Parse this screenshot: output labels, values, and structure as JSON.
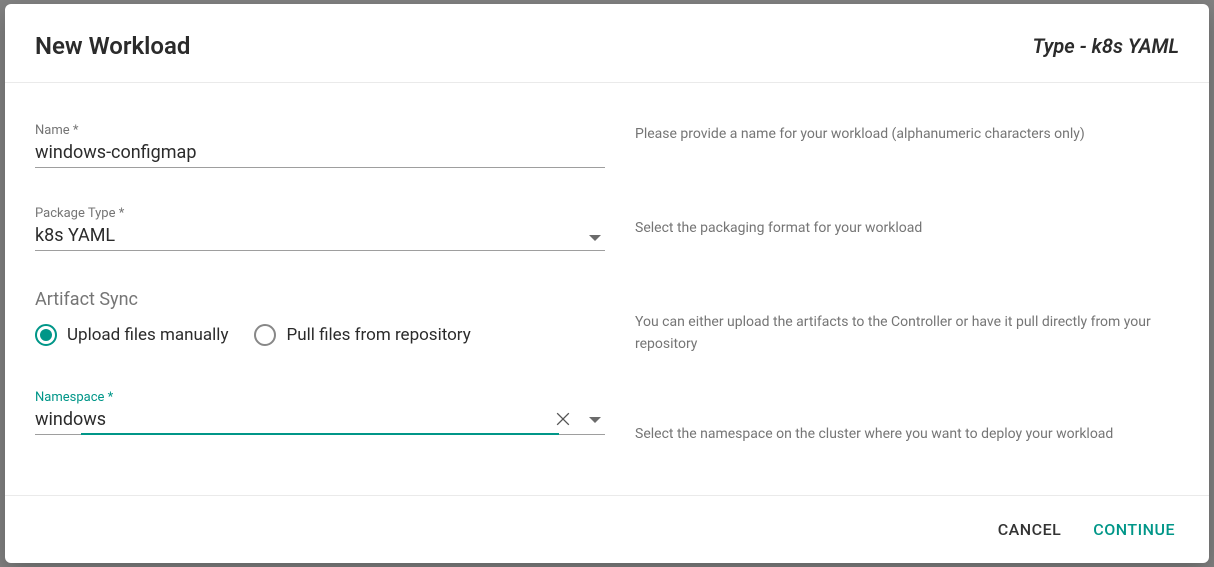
{
  "header": {
    "title": "New Workload",
    "type_label": "Type - k8s YAML"
  },
  "form": {
    "name": {
      "label": "Name *",
      "value": "windows-configmap"
    },
    "package_type": {
      "label": "Package Type *",
      "value": "k8s YAML"
    },
    "artifact_sync": {
      "title": "Artifact Sync",
      "options": {
        "upload": "Upload files manually",
        "pull": "Pull files from repository"
      },
      "selected": "upload"
    },
    "namespace": {
      "label": "Namespace *",
      "value": "windows"
    }
  },
  "help": {
    "name": "Please provide a name for your workload (alphanumeric characters only)",
    "package_type": "Select the packaging format for your workload",
    "artifact_sync": "You can either upload the artifacts to the Controller or have it pull directly from your repository",
    "namespace": "Select the namespace on the cluster where you want to deploy your workload"
  },
  "footer": {
    "cancel": "CANCEL",
    "continue": "CONTINUE"
  },
  "colors": {
    "accent": "#009688"
  }
}
